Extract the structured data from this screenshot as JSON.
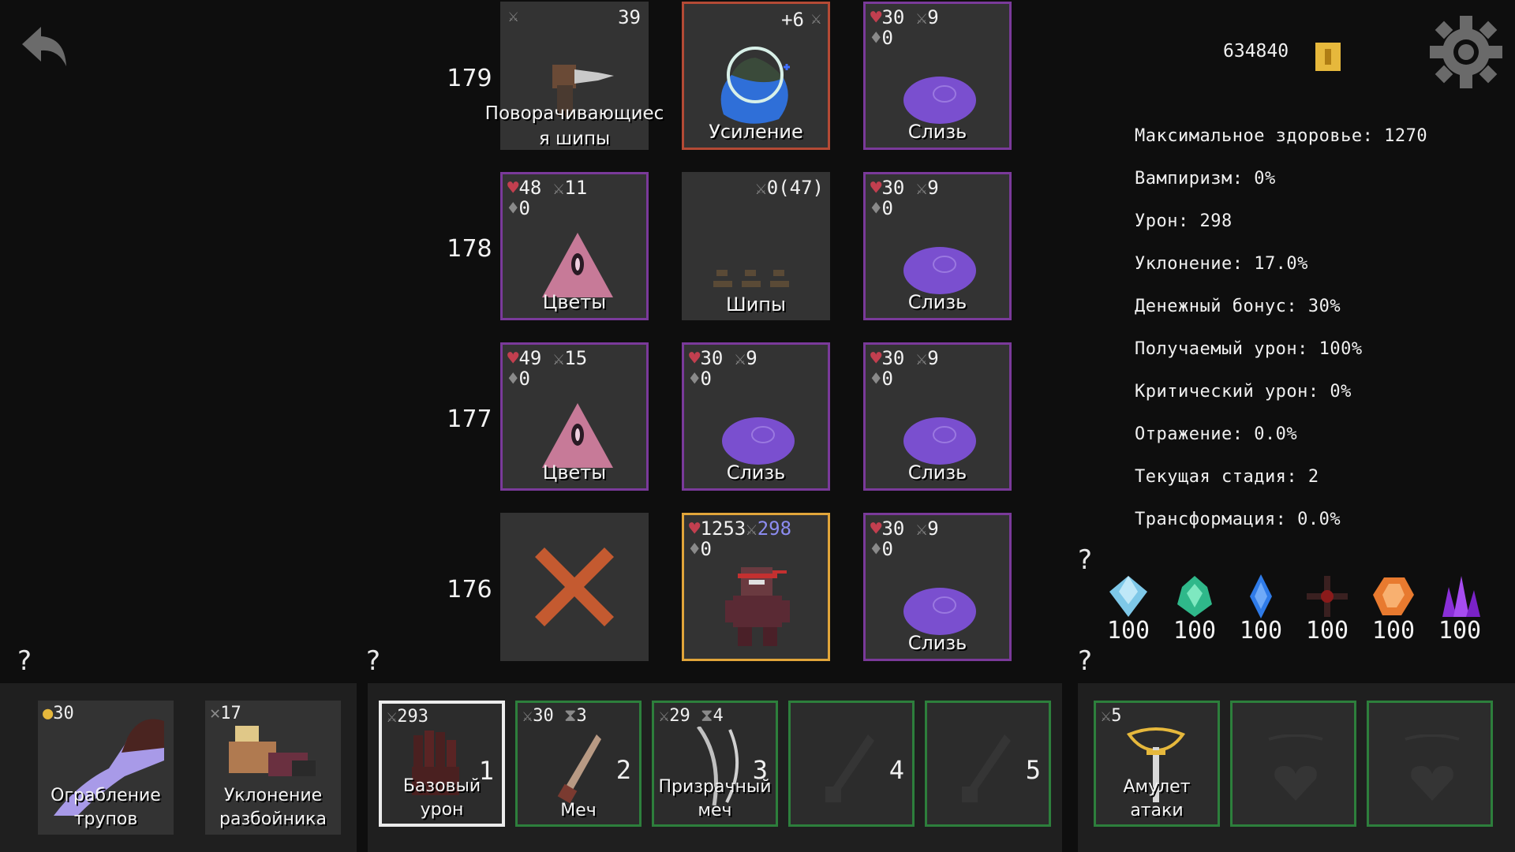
{
  "floors": [
    "179",
    "178",
    "177",
    "176"
  ],
  "grid": {
    "r179": {
      "c1": {
        "top": "39",
        "label": "Поворачивающиеся шипы"
      },
      "c2": {
        "top": "+6",
        "label": "Усиление"
      },
      "c3": {
        "hp": "30",
        "atk": "9",
        "def": "0",
        "label": "Слизь"
      }
    },
    "r178": {
      "c1": {
        "hp": "48",
        "atk": "11",
        "def": "0",
        "label": "Цветы"
      },
      "c2": {
        "top": "0(47)",
        "label": "Шипы"
      },
      "c3": {
        "hp": "30",
        "atk": "9",
        "def": "0",
        "label": "Слизь"
      }
    },
    "r177": {
      "c1": {
        "hp": "49",
        "atk": "15",
        "def": "0",
        "label": "Цветы"
      },
      "c2": {
        "hp": "30",
        "atk": "9",
        "def": "0",
        "label": "Слизь"
      },
      "c3": {
        "hp": "30",
        "atk": "9",
        "def": "0",
        "label": "Слизь"
      }
    },
    "r176": {
      "c2": {
        "hp": "1253",
        "atk": "298",
        "def": "0"
      },
      "c3": {
        "hp": "30",
        "atk": "9",
        "def": "0",
        "label": "Слизь"
      }
    }
  },
  "currency": {
    "amount": "634840"
  },
  "stats": [
    "Максимальное здоровье: 1270",
    "Вампиризм: 0%",
    "Урон: 298",
    "Уклонение: 17.0%",
    "Денежный бонус: 30%",
    "Получаемый урон: 100%",
    "Критический урон: 0%",
    "Отражение: 0.0%",
    "Текущая стадия: 2",
    "Трансформация: 0.0%"
  ],
  "gems": [
    "100",
    "100",
    "100",
    "100",
    "100",
    "100"
  ],
  "help_glyph": "?",
  "skills": [
    {
      "stat": "30",
      "label": "Ограбление трупов"
    },
    {
      "stat": "17",
      "label": "Уклонение разбойника"
    }
  ],
  "weapons": [
    {
      "stat": "293",
      "label": "Базовый урон",
      "num": "1"
    },
    {
      "stat": "30",
      "stat2": "3",
      "label": "Меч",
      "num": "2"
    },
    {
      "stat": "29",
      "stat2": "4",
      "label": "Призрачный меч",
      "num": "3"
    },
    {
      "num": "4"
    },
    {
      "num": "5"
    }
  ],
  "amulets": [
    {
      "stat": "5",
      "label": "Амулет атаки"
    }
  ],
  "colors": {
    "background": "#0e0e0e",
    "cell": "#333333",
    "border_purple": "#7a3a9a",
    "border_orange": "#e1a53a",
    "border_red": "#b44a35",
    "slot_green": "#2d7f3c",
    "heart": "#c23f4f",
    "slime": "#7a4fcf",
    "cross": "#c45a30"
  }
}
